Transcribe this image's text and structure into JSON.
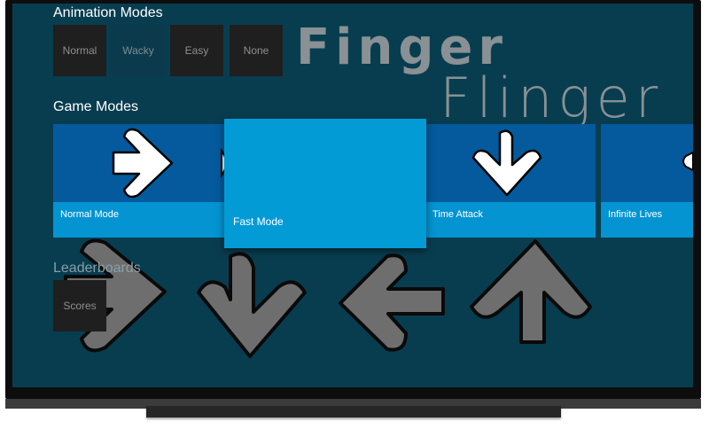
{
  "logo": {
    "line1": "Finger",
    "line2": "Flinger"
  },
  "animation_modes": {
    "title": "Animation Modes",
    "options": [
      "Normal",
      "Wacky",
      "Easy",
      "None"
    ],
    "selected": "Wacky"
  },
  "game_modes": {
    "title": "Game Modes",
    "cards": [
      {
        "label": "Normal Mode",
        "icon": "arrow-right-icon"
      },
      {
        "label": "Fast Mode",
        "icon": "arrow-icon",
        "focused": true
      },
      {
        "label": "Time Attack",
        "icon": "arrow-down-icon"
      },
      {
        "label": "Infinite Lives",
        "icon": "arrow-icon"
      }
    ]
  },
  "leaderboards": {
    "title": "Leaderboards",
    "options": [
      "Scores"
    ]
  },
  "colors": {
    "background": "#083d50",
    "card_top": "#045a9c",
    "card_bottom": "#0494d1",
    "card_focused": "#039bd6",
    "button": "#1f1f1f"
  }
}
